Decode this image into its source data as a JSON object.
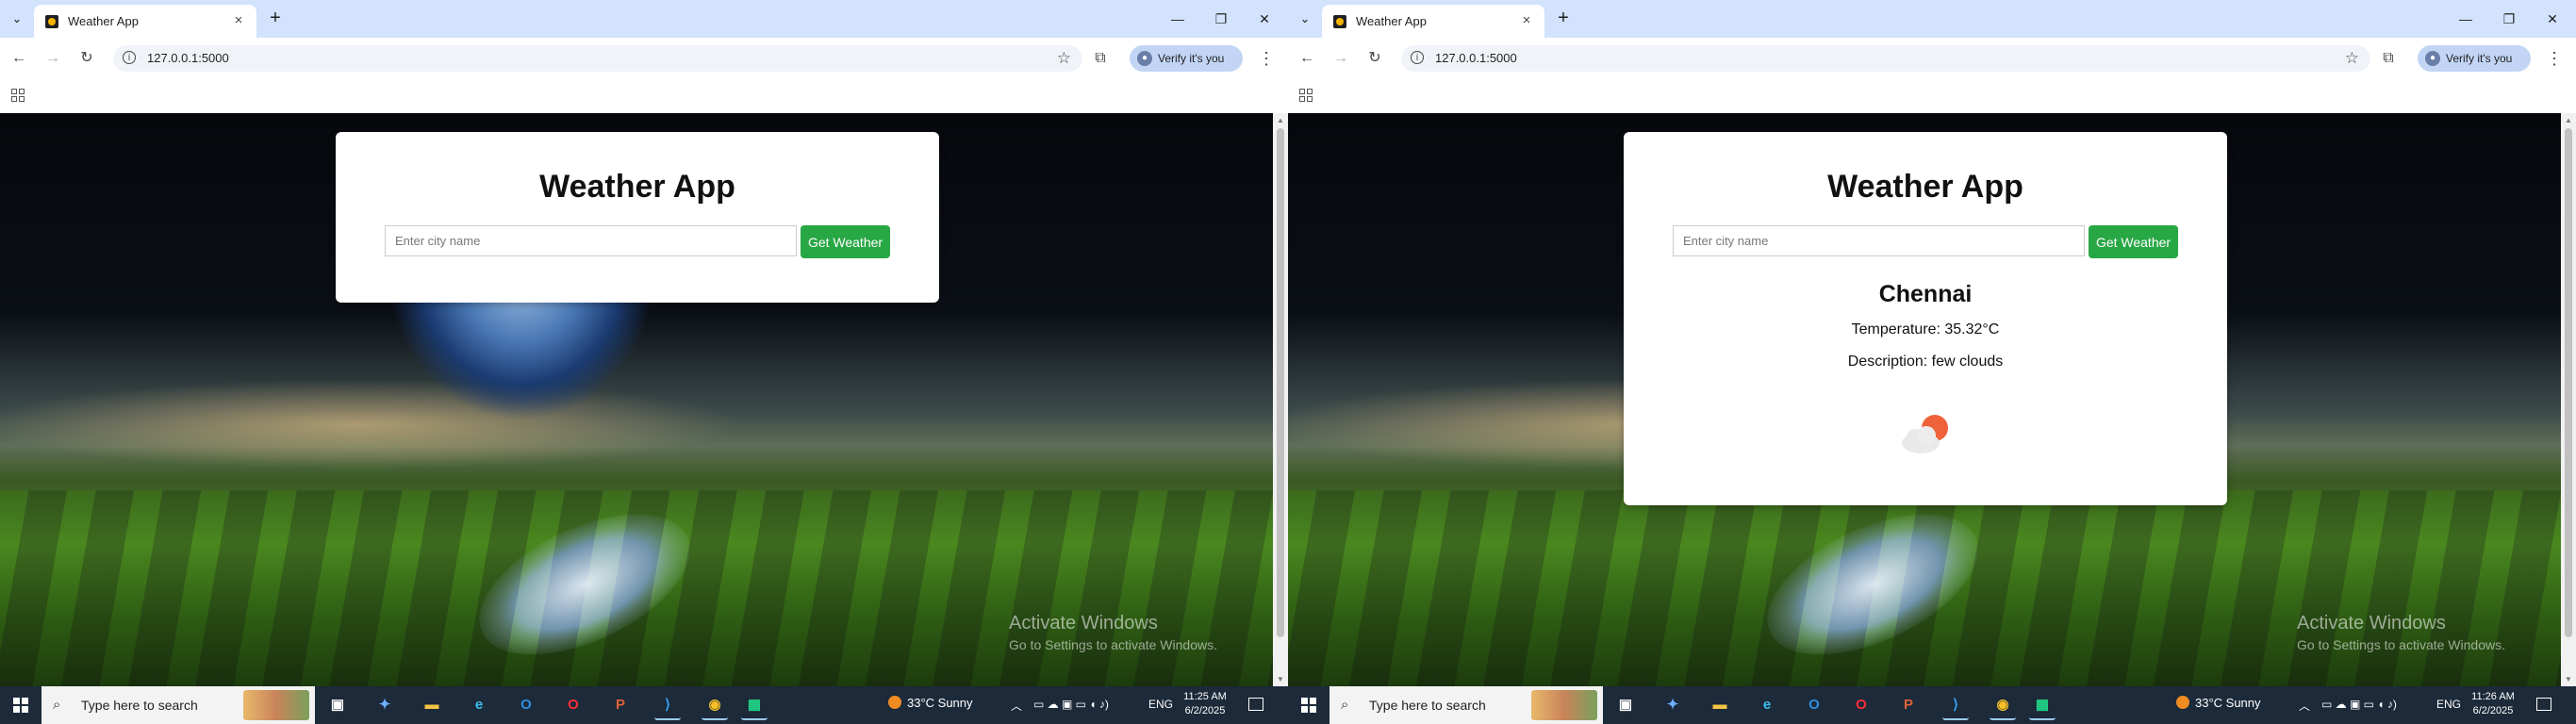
{
  "screens": [
    {
      "tab": {
        "title": "Weather App"
      },
      "address": {
        "url": "127.0.0.1:5000"
      },
      "profile": {
        "label": "Verify it's you"
      },
      "card": {
        "title": "Weather App",
        "input_placeholder": "Enter city name",
        "button_label": "Get Weather",
        "result": null
      },
      "taskbar": {
        "search_placeholder": "Type here to search",
        "weather": "33°C  Sunny",
        "lang": "ENG",
        "time": "11:25 AM",
        "date": "6/2/2025"
      }
    },
    {
      "tab": {
        "title": "Weather App"
      },
      "address": {
        "url": "127.0.0.1:5000"
      },
      "profile": {
        "label": "Verify it's you"
      },
      "card": {
        "title": "Weather App",
        "input_placeholder": "Enter city name",
        "button_label": "Get Weather",
        "result": {
          "city": "Chennai",
          "temperature": "Temperature: 35.32°C",
          "description": "Description: few clouds",
          "icon": "few-clouds-icon"
        }
      },
      "watermark": {
        "line1": "Activate Windows",
        "line2": "Go to Settings to activate Windows."
      },
      "taskbar": {
        "search_placeholder": "Type here to search",
        "weather": "33°C  Sunny",
        "lang": "ENG",
        "time": "11:26 AM",
        "date": "6/2/2025"
      }
    }
  ],
  "left_watermark": {
    "line1": "Activate Windows",
    "line2": "Go to Settings to activate Windows."
  },
  "taskbar_apps": [
    "task-view",
    "copilot",
    "file-explorer",
    "edge",
    "outlook",
    "opera",
    "powerpoint",
    "vscode",
    "chrome",
    "pycharm"
  ],
  "colors": {
    "accent_button": "#28a745",
    "tab_strip": "#d3e3fd",
    "taskbar": "#1c2a3a"
  }
}
